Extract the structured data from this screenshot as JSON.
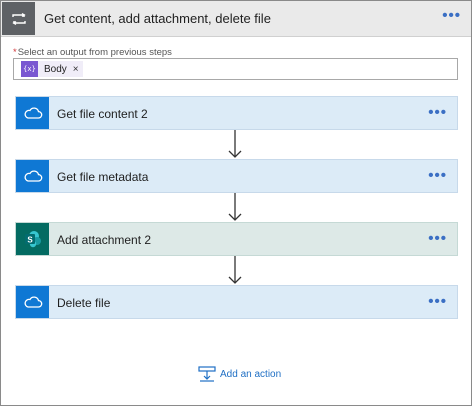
{
  "scope": {
    "title": "Get content, add attachment, delete file",
    "more_label": "•••",
    "icon": "loop-icon"
  },
  "select_output": {
    "required_mark": "*",
    "label": "Select an output from previous steps",
    "token": {
      "icon_text": "{x}",
      "label": "Body",
      "remove_label": "×"
    }
  },
  "actions": [
    {
      "title": "Get file content 2",
      "icon": "onedrive-cloud-icon",
      "connector": "onedrive",
      "more_label": "•••"
    },
    {
      "title": "Get file metadata",
      "icon": "onedrive-cloud-icon",
      "connector": "onedrive",
      "more_label": "•••"
    },
    {
      "title": "Add attachment 2",
      "icon": "sharepoint-icon",
      "connector": "sharepoint",
      "more_label": "•••"
    },
    {
      "title": "Delete file",
      "icon": "onedrive-cloud-icon",
      "connector": "onedrive",
      "more_label": "•••"
    }
  ],
  "add_action": {
    "label": "Add an action",
    "icon": "add-action-icon"
  },
  "colors": {
    "onedrive": "#0f78d4",
    "sharepoint": "#046b62",
    "token": "#7a57d1",
    "link": "#1f6fc4",
    "header": "#eaeaea",
    "card_blue": "#dcebf7",
    "card_green": "#dde9e7"
  }
}
